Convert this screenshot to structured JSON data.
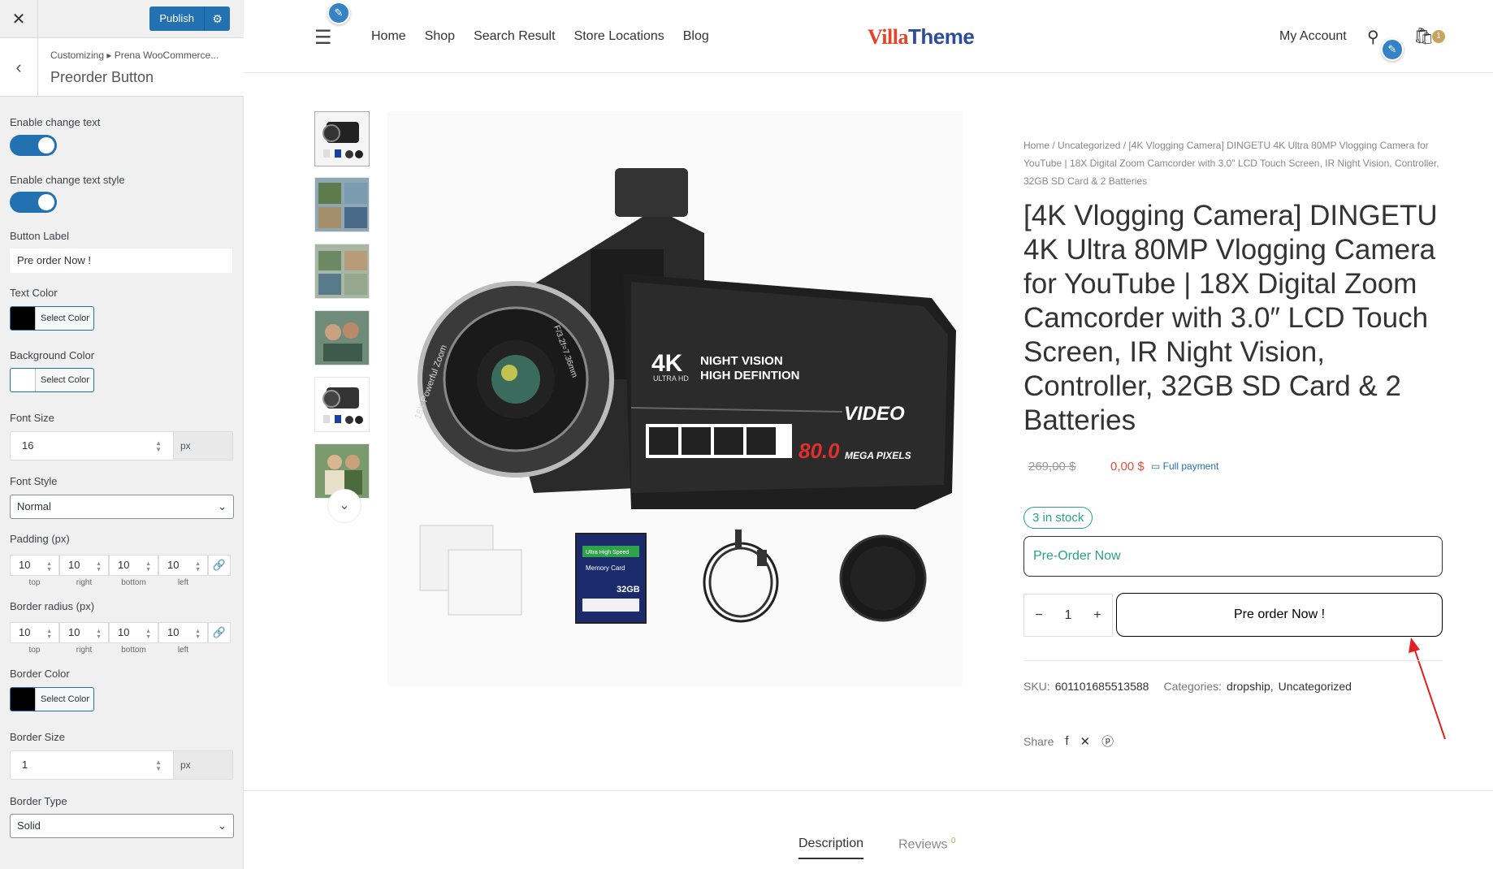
{
  "customizer": {
    "close_icon": "close-icon",
    "publish_label": "Publish",
    "breadcrumb": "Customizing ▸ Prena WooCommerce...",
    "section_title": "Preorder Button",
    "controls": {
      "enable_change_text": "Enable change text",
      "enable_change_text_style": "Enable change text style",
      "button_label": "Button Label",
      "button_label_value": "Pre order Now !",
      "text_color": "Text Color",
      "text_color_value": "#000000",
      "background_color": "Background Color",
      "background_color_value": "#ffffff",
      "select_color": "Select Color",
      "font_size": "Font Size",
      "font_size_value": "16",
      "unit_px": "px",
      "font_style": "Font Style",
      "font_style_value": "Normal",
      "padding": "Padding (px)",
      "padding_values": [
        "10",
        "10",
        "10",
        "10"
      ],
      "border_radius": "Border radius (px)",
      "border_radius_values": [
        "10",
        "10",
        "10",
        "10"
      ],
      "side_labels": [
        "top",
        "right",
        "bottom",
        "left"
      ],
      "border_color": "Border Color",
      "border_color_value": "#000000",
      "border_size": "Border Size",
      "border_size_value": "1",
      "border_type": "Border Type",
      "border_type_value": "Solid"
    }
  },
  "site": {
    "nav": [
      "Home",
      "Shop",
      "Search Result",
      "Store Locations",
      "Blog"
    ],
    "logo_part1": "Villa",
    "logo_part2": "Theme",
    "my_account": "My Account",
    "cart_count": "1"
  },
  "product": {
    "breadcrumb": "Home  /  Uncategorized  /  [4K Vlogging Camera] DINGETU 4K Ultra 80MP Vlogging Camera for YouTube | 18X Digital Zoom Camcorder with 3.0\" LCD Touch Screen, IR Night Vision, Controller, 32GB SD Card & 2 Batteries",
    "title": "[4K Vlogging Camera] DINGETU 4K Ultra 80MP Vlogging Camera for YouTube | 18X Digital Zoom Camcorder with 3.0″ LCD Touch Screen, IR Night Vision, Controller, 32GB SD Card & 2 Batteries",
    "price_old": "269,00 $",
    "price_new": "0,00 $",
    "full_payment": "Full payment",
    "stock": "3 in stock",
    "preorder_notice": "Pre-Order Now",
    "qty": "1",
    "preorder_button": "Pre order Now !",
    "sku_label": "SKU:",
    "sku_value": "601101685513588",
    "categories_label": "Categories:",
    "category_1": "dropship,",
    "category_2": "Uncategorized",
    "share_label": "Share",
    "image_texts": {
      "badge": "4K",
      "badge_sub": "ULTRA HD",
      "night_vision": "NIGHT VISION",
      "high_def": "HIGH DEFINTION",
      "video": "VIDEO",
      "megapixels": "80.0",
      "megapixels_unit": "MEGA PIXELS",
      "lens_text": "18X Powerful Zoom",
      "lens_spec": "F/3.2f=7.36mm",
      "sd_card_size": "32GB",
      "sd_card_top": "Ultra High Speed",
      "sd_card_mid": "Memory Card"
    }
  },
  "tabs": {
    "description": "Description",
    "reviews": "Reviews",
    "reviews_count": "0"
  },
  "colors": {
    "accent": "#2271b1",
    "stock_green": "#2aa08a",
    "sale_red": "#e74c3c",
    "logo_red": "#e4442a",
    "logo_blue": "#2d4d9a"
  }
}
